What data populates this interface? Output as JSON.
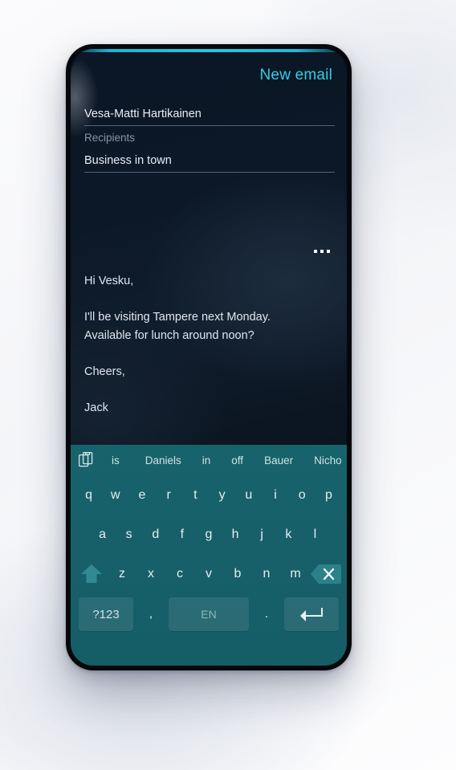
{
  "app": {
    "title": "New email",
    "accent_color": "#22c8e4"
  },
  "compose": {
    "recipient_value": "Vesa-Matti Hartikainen",
    "recipients_label": "Recipients",
    "subject_value": "Business in town",
    "more_icon": "more-horizontal-icon",
    "body_paragraphs": [
      "Hi Vesku,",
      "I'll be visiting Tampere next Monday.\nAvailable for lunch around noon?",
      "Cheers,",
      "Jack"
    ]
  },
  "keyboard": {
    "clipboard_icon": "clipboard-icon",
    "suggestions": [
      "is",
      "Daniels",
      "in",
      "off",
      "Bauer",
      "Nicho"
    ],
    "row1": [
      "q",
      "w",
      "e",
      "r",
      "t",
      "y",
      "u",
      "i",
      "o",
      "p"
    ],
    "row2": [
      "a",
      "s",
      "d",
      "f",
      "g",
      "h",
      "j",
      "k",
      "l"
    ],
    "row3": [
      "z",
      "x",
      "c",
      "v",
      "b",
      "n",
      "m"
    ],
    "shift_icon": "shift-arrow-icon",
    "backspace_icon": "backspace-icon",
    "symbols_label": "?123",
    "comma_label": ",",
    "space_label": "EN",
    "period_label": ".",
    "enter_icon": "enter-arrow-icon"
  }
}
